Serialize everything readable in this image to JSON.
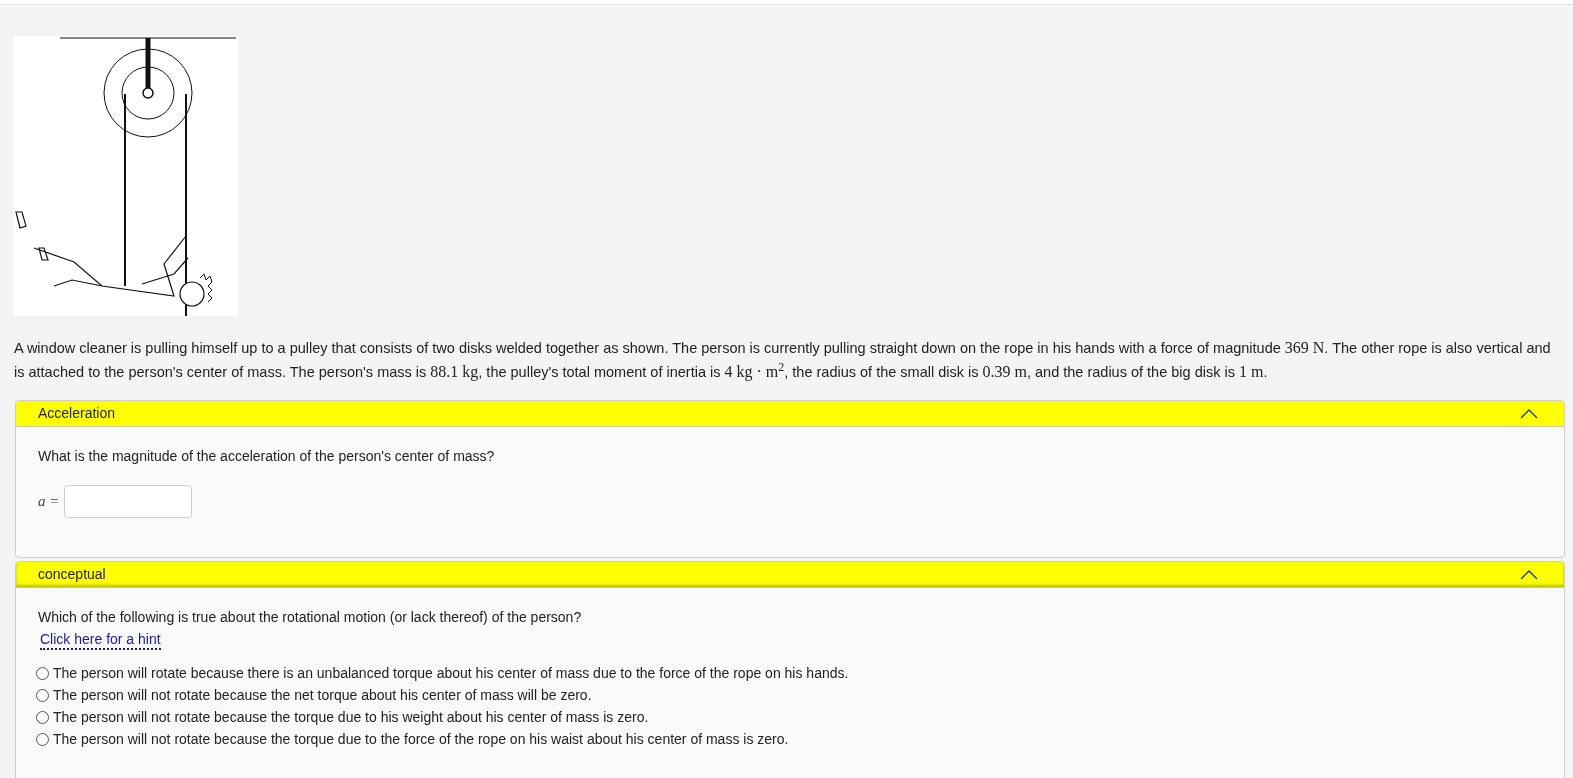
{
  "problem": [
    {
      "kind": "text",
      "text": "A window cleaner is pulling himself up to a pulley that consists of two disks welded together as shown. The person is currently pulling straight down on the rope in his hands with a force of magnitude "
    },
    {
      "kind": "math",
      "text": "369 N"
    },
    {
      "kind": "text",
      "text": ". The other rope is also vertical and is attached to the person's center of mass. The person's mass is "
    },
    {
      "kind": "math",
      "text": "88.1 kg"
    },
    {
      "kind": "text",
      "text": ", the pulley's total moment of inertia is "
    },
    {
      "kind": "math",
      "text": "4 kg · m$^{2}$"
    },
    {
      "kind": "text",
      "text": ", the radius of the small disk is "
    },
    {
      "kind": "math",
      "text": "0.39 m"
    },
    {
      "kind": "text",
      "text": ", and the radius of the big disk is "
    },
    {
      "kind": "math",
      "text": "1 m"
    },
    {
      "kind": "text",
      "text": "."
    }
  ],
  "parts": [
    {
      "kind": "answer",
      "title": "Acceleration",
      "expanded": true,
      "question": "What is the magnitude of the acceleration of the person's center of mass?",
      "field_label": "a ="
    },
    {
      "kind": "choice",
      "title": "conceptual",
      "expanded": true,
      "question": "Which of the following is true about the rotational motion (or lack thereof) of the person?",
      "hint_link": "Click here for a hint",
      "options": [
        {
          "label": "The person will rotate because there is an unbalanced torque about his center of mass due to the force of the rope on his hands.",
          "selected": false
        },
        {
          "label": "The person will not rotate because the net torque about his center of mass will be zero.",
          "selected": false
        },
        {
          "label": "The person will not rotate because the torque due to his weight about his center of mass is zero.",
          "selected": false
        },
        {
          "label": "The person will not rotate because the torque due to the force of the rope on his waist about his center of mass is zero.",
          "selected": false
        }
      ]
    }
  ]
}
